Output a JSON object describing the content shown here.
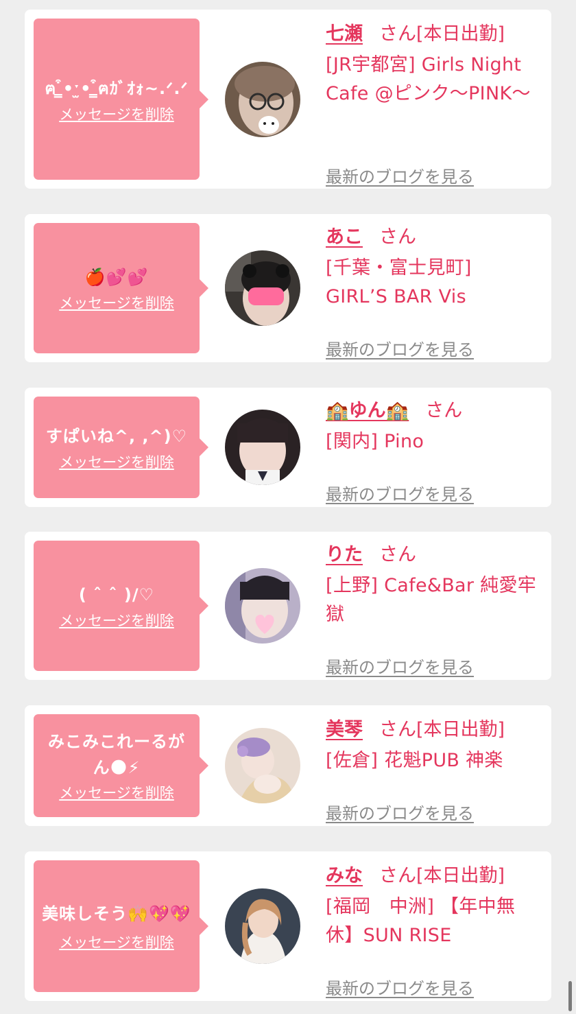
{
  "ui": {
    "delete_label": "メッセージを削除",
    "blog_label": "最新のブログを見る",
    "honorific": "さん"
  },
  "cards": [
    {
      "message": "ฅ ̳͒•ˑ̫• ̳͒ฅｶﾞｵｫ~.ᐟ.ᐟ",
      "name": "七瀬",
      "status": "[本日出勤]",
      "shop": "[JR宇都宮] Girls Night Cafe @ピンク〜PINK〜"
    },
    {
      "message": "🍎💕💕",
      "name": "あこ",
      "status": "",
      "shop": "[千葉・富士見町] GIRL’S BAR Vis"
    },
    {
      "message": "すぱいね^, ,^)♡",
      "name": "🏫ゆん🏫",
      "status": "",
      "shop": "[関内] Pino"
    },
    {
      "message": "( ˆ ˆ )/♡",
      "name": "りた",
      "status": "",
      "shop": "[上野] Cafe&Bar 純愛牢獄"
    },
    {
      "message": "みこみこれーるがん🌑⚡",
      "name": "美琴",
      "status": "[本日出勤]",
      "shop": "[佐倉] 花魁PUB 神楽"
    },
    {
      "message": "美味しそう🙌💖💖",
      "name": "みな",
      "status": "[本日出勤]",
      "shop": "[福岡　中洲] 【年中無休】SUN RISE"
    }
  ],
  "colors": {
    "accent": "#e4365d",
    "bubble": "#f8919f",
    "link_gray": "#8a8a8a",
    "background": "#eeeeee"
  }
}
